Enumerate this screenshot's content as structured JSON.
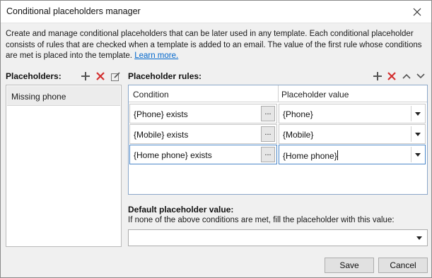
{
  "window": {
    "title": "Conditional placeholders manager"
  },
  "description": {
    "text": "Create and manage conditional placeholders that can be later used in any template. Each conditional placeholder consists of rules that are checked when a template is added to an email. The value of the first rule whose conditions are met is placed into the template.",
    "link": "Learn more."
  },
  "placeholders": {
    "label": "Placeholders:",
    "items": [
      {
        "name": "Missing phone"
      }
    ]
  },
  "rules": {
    "label": "Placeholder rules:",
    "columns": {
      "condition": "Condition",
      "value": "Placeholder value"
    },
    "rows": [
      {
        "condition": "{Phone} exists",
        "value": "{Phone}",
        "ellipsis": "...",
        "active": false
      },
      {
        "condition": "{Mobile} exists",
        "value": "{Mobile}",
        "ellipsis": "...",
        "active": false
      },
      {
        "condition": "{Home phone} exists",
        "value": "{Home phone}",
        "ellipsis": "...",
        "active": true
      }
    ]
  },
  "default_value": {
    "label": "Default placeholder value:",
    "hint": "If none of the above conditions are met, fill the placeholder with this value:",
    "value": ""
  },
  "buttons": {
    "save": "Save",
    "cancel": "Cancel"
  },
  "colors": {
    "add_icon": "#555555",
    "delete_icon": "#d32f2f",
    "link": "#0066cc",
    "grid_border": "#8aa6c8"
  }
}
